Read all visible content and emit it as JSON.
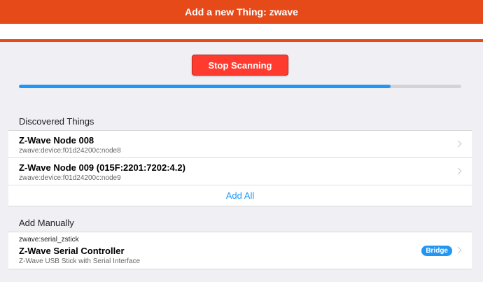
{
  "navbar": {
    "title": "Add a new Thing: zwave"
  },
  "scan": {
    "stop_label": "Stop Scanning",
    "progress_percent": 84
  },
  "discovered": {
    "section_title": "Discovered Things",
    "items": [
      {
        "title": "Z-Wave Node 008",
        "subtitle": "zwave:device:f01d24200c:node8"
      },
      {
        "title": "Z-Wave Node 009 (015F:2201:7202:4.2)",
        "subtitle": "zwave:device:f01d24200c:node9"
      }
    ],
    "add_all_label": "Add All"
  },
  "manual": {
    "section_title": "Add Manually",
    "items": [
      {
        "header": "zwave:serial_zstick",
        "title": "Z-Wave Serial Controller",
        "subtitle": "Z-Wave USB Stick with Serial Interface",
        "badge": "Bridge"
      }
    ]
  },
  "colors": {
    "accent": "#e64a19",
    "stop_button": "#ff3b30",
    "progress": "#2196f3",
    "link": "#2196f3",
    "background": "#efeff4"
  },
  "icons": {
    "list_chevron": "chevron-right-icon"
  }
}
